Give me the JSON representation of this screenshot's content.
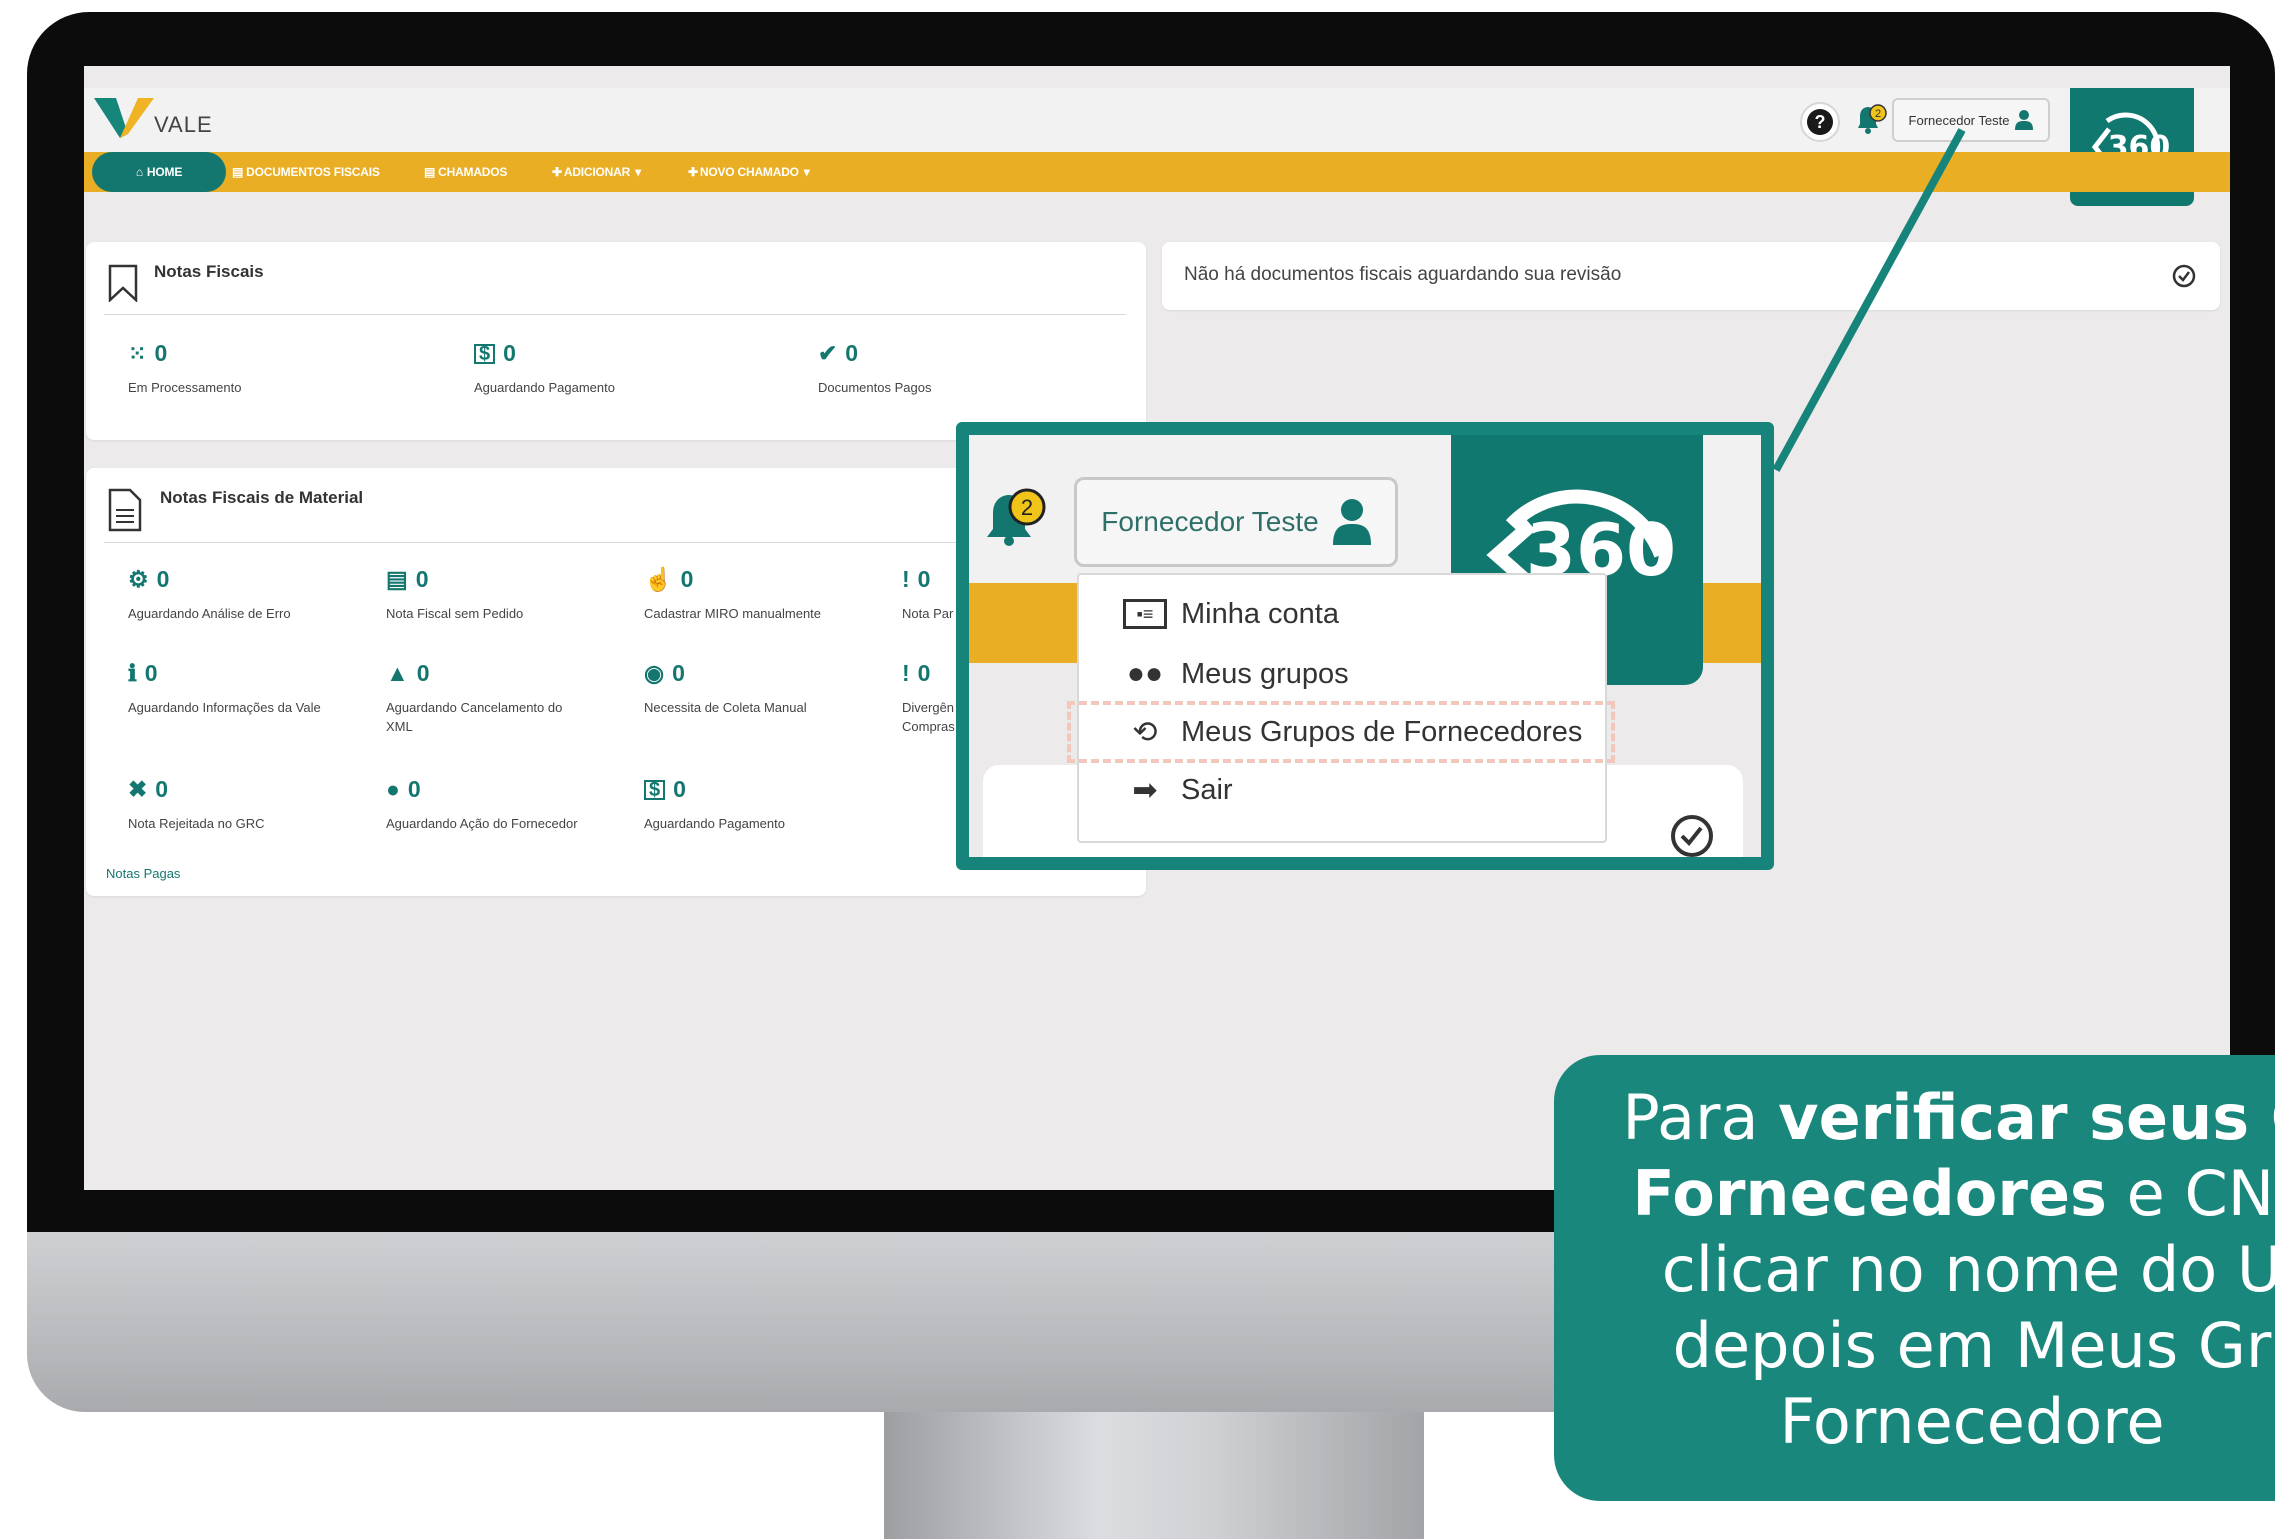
{
  "app": {
    "brand": "VALE",
    "help_glyph": "?",
    "notification_count": "2",
    "user_name": "Fornecedor Teste",
    "logo_360_text": "360"
  },
  "nav": {
    "home": "HOME",
    "documentos_fiscais": "DOCUMENTOS FISCAIS",
    "chamados": "CHAMADOS",
    "adicionar": "ADICIONAR",
    "novo_chamado": "NOVO CHAMADO"
  },
  "notas_fiscais": {
    "title": "Notas Fiscais",
    "stats": [
      {
        "value": "0",
        "label": "Em Processamento"
      },
      {
        "value": "0",
        "label": "Aguardando Pagamento"
      },
      {
        "value": "0",
        "label": "Documentos Pagos"
      }
    ]
  },
  "revisao": {
    "message": "Não há documentos fiscais aguardando sua revisão"
  },
  "notas_material": {
    "title": "Notas Fiscais de Material",
    "stats": [
      {
        "value": "0",
        "label": "Aguardando Análise de Erro"
      },
      {
        "value": "0",
        "label": "Nota Fiscal sem Pedido"
      },
      {
        "value": "0",
        "label": "Cadastrar MIRO manualmente"
      },
      {
        "value": "0",
        "label": "Nota Par"
      },
      {
        "value": "0",
        "label": "Aguardando Informações da Vale"
      },
      {
        "value": "0",
        "label": "Aguardando Cancelamento do XML"
      },
      {
        "value": "0",
        "label": "Necessita de Coleta Manual"
      },
      {
        "value": "0",
        "label": "Divergên Compras"
      },
      {
        "value": "0",
        "label": "Nota Rejeitada no GRC"
      },
      {
        "value": "0",
        "label": "Aguardando Ação do Fornecedor"
      },
      {
        "value": "0",
        "label": "Aguardando Pagamento"
      }
    ],
    "footer_link": "Notas Pagas"
  },
  "zoom": {
    "notification_count": "2",
    "user_name": "Fornecedor Teste",
    "menu": [
      {
        "label": "Minha conta",
        "icon": "id-card-icon"
      },
      {
        "label": "Meus grupos",
        "icon": "users-icon"
      },
      {
        "label": "Meus Grupos de Fornecedores",
        "icon": "handshake-icon"
      },
      {
        "label": "Sair",
        "icon": "sign-out-icon"
      }
    ],
    "logo_partial": "360"
  },
  "info": {
    "line1_normal": "Para ",
    "line1_bold": "verificar seus G",
    "line2_bold": "Fornecedores",
    "line2_normal": " e CNP",
    "line3": "clicar no nome do U",
    "line4": "depois em Meus Gr",
    "line5": "Fornecedore"
  },
  "colors": {
    "teal": "#14776f",
    "gold": "#e9ae23",
    "callout_teal": "#1a877d"
  }
}
